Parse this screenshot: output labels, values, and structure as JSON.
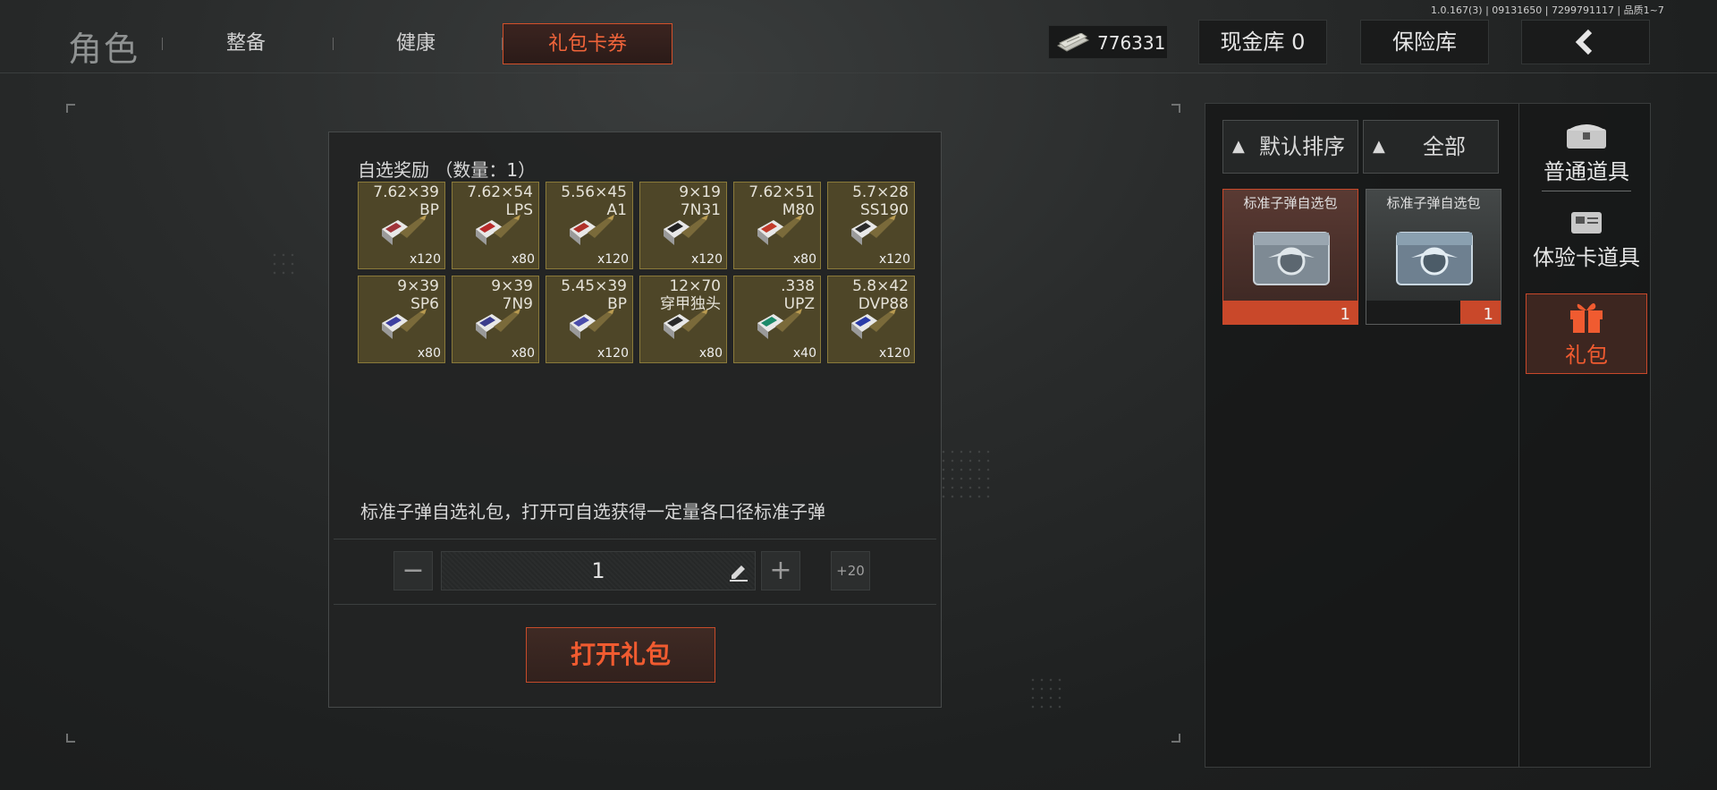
{
  "version": "1.0.167(3) | 09131650 | 7299791117 | 品质1~7",
  "header": {
    "title": "角色",
    "tabs": [
      {
        "label": "整备",
        "active": false
      },
      {
        "label": "健康",
        "active": false
      },
      {
        "label": "礼包卡券",
        "active": true
      }
    ],
    "money": "776331",
    "cash_vault": "现金库 0",
    "safe_box": "保险库",
    "back_icon": "chevron-left-icon"
  },
  "panel": {
    "reward_title": "自选奖励 （数量：1）",
    "rewards": [
      {
        "caliber": "7.62×39\nBP",
        "qty": "x120",
        "color": "#a0343a"
      },
      {
        "caliber": "7.62×54\nLPS",
        "qty": "x80",
        "color": "#b82a2a"
      },
      {
        "caliber": "5.56×45\nA1",
        "qty": "x120",
        "color": "#b0302a"
      },
      {
        "caliber": "9×19\n7N31",
        "qty": "x120",
        "color": "#222222"
      },
      {
        "caliber": "7.62×51\nM80",
        "qty": "x80",
        "color": "#c23a2a"
      },
      {
        "caliber": "5.7×28\nSS190",
        "qty": "x120",
        "color": "#2a2a2a"
      },
      {
        "caliber": "9×39\nSP6",
        "qty": "x80",
        "color": "#3d3fa0"
      },
      {
        "caliber": "9×39\n7N9",
        "qty": "x80",
        "color": "#3b3c8c"
      },
      {
        "caliber": "5.45×39\nBP",
        "qty": "x120",
        "color": "#4a4cab"
      },
      {
        "caliber": "12×70\n穿甲独头",
        "qty": "x80",
        "color": "#2a2a2a"
      },
      {
        "caliber": ".338\nUPZ",
        "qty": "x40",
        "color": "#1c8a6a"
      },
      {
        "caliber": "5.8×42\nDVP88",
        "qty": "x120",
        "color": "#2a3ba8"
      }
    ],
    "description": "标准子弹自选礼包，打开可自选获得一定量各口径标准子弹",
    "quantity": "1",
    "plus20": "+20",
    "open_button": "打开礼包"
  },
  "inventory": {
    "sort_label": "默认排序",
    "filter_label": "全部",
    "items": [
      {
        "name": "标准子弹自选包",
        "count": "1",
        "selected": true
      },
      {
        "name": "标准子弹自选包",
        "count": "1",
        "selected": false
      }
    ],
    "categories": [
      {
        "label": "普通道具",
        "icon": "chest-icon",
        "active": false
      },
      {
        "label": "体验卡道具",
        "icon": "card-icon",
        "active": false
      },
      {
        "label": "礼包",
        "icon": "gift-icon",
        "active": true
      }
    ]
  },
  "colors": {
    "accent": "#f05b30",
    "slot_gold": "#4e4628",
    "panel_bg": "#222424"
  }
}
